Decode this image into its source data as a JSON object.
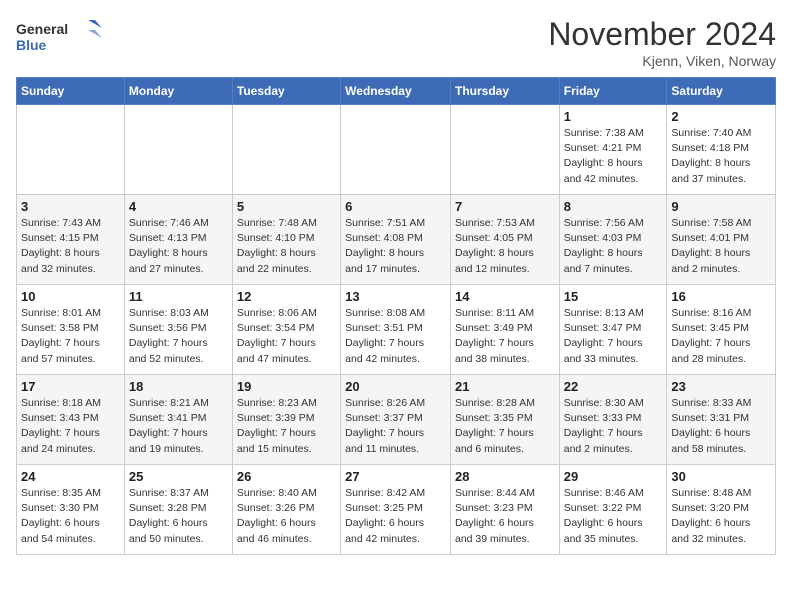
{
  "header": {
    "logo_line1": "General",
    "logo_line2": "Blue",
    "month_title": "November 2024",
    "location": "Kjenn, Viken, Norway"
  },
  "days_of_week": [
    "Sunday",
    "Monday",
    "Tuesday",
    "Wednesday",
    "Thursday",
    "Friday",
    "Saturday"
  ],
  "weeks": [
    [
      {
        "day": "",
        "info": ""
      },
      {
        "day": "",
        "info": ""
      },
      {
        "day": "",
        "info": ""
      },
      {
        "day": "",
        "info": ""
      },
      {
        "day": "",
        "info": ""
      },
      {
        "day": "1",
        "info": "Sunrise: 7:38 AM\nSunset: 4:21 PM\nDaylight: 8 hours\nand 42 minutes."
      },
      {
        "day": "2",
        "info": "Sunrise: 7:40 AM\nSunset: 4:18 PM\nDaylight: 8 hours\nand 37 minutes."
      }
    ],
    [
      {
        "day": "3",
        "info": "Sunrise: 7:43 AM\nSunset: 4:15 PM\nDaylight: 8 hours\nand 32 minutes."
      },
      {
        "day": "4",
        "info": "Sunrise: 7:46 AM\nSunset: 4:13 PM\nDaylight: 8 hours\nand 27 minutes."
      },
      {
        "day": "5",
        "info": "Sunrise: 7:48 AM\nSunset: 4:10 PM\nDaylight: 8 hours\nand 22 minutes."
      },
      {
        "day": "6",
        "info": "Sunrise: 7:51 AM\nSunset: 4:08 PM\nDaylight: 8 hours\nand 17 minutes."
      },
      {
        "day": "7",
        "info": "Sunrise: 7:53 AM\nSunset: 4:05 PM\nDaylight: 8 hours\nand 12 minutes."
      },
      {
        "day": "8",
        "info": "Sunrise: 7:56 AM\nSunset: 4:03 PM\nDaylight: 8 hours\nand 7 minutes."
      },
      {
        "day": "9",
        "info": "Sunrise: 7:58 AM\nSunset: 4:01 PM\nDaylight: 8 hours\nand 2 minutes."
      }
    ],
    [
      {
        "day": "10",
        "info": "Sunrise: 8:01 AM\nSunset: 3:58 PM\nDaylight: 7 hours\nand 57 minutes."
      },
      {
        "day": "11",
        "info": "Sunrise: 8:03 AM\nSunset: 3:56 PM\nDaylight: 7 hours\nand 52 minutes."
      },
      {
        "day": "12",
        "info": "Sunrise: 8:06 AM\nSunset: 3:54 PM\nDaylight: 7 hours\nand 47 minutes."
      },
      {
        "day": "13",
        "info": "Sunrise: 8:08 AM\nSunset: 3:51 PM\nDaylight: 7 hours\nand 42 minutes."
      },
      {
        "day": "14",
        "info": "Sunrise: 8:11 AM\nSunset: 3:49 PM\nDaylight: 7 hours\nand 38 minutes."
      },
      {
        "day": "15",
        "info": "Sunrise: 8:13 AM\nSunset: 3:47 PM\nDaylight: 7 hours\nand 33 minutes."
      },
      {
        "day": "16",
        "info": "Sunrise: 8:16 AM\nSunset: 3:45 PM\nDaylight: 7 hours\nand 28 minutes."
      }
    ],
    [
      {
        "day": "17",
        "info": "Sunrise: 8:18 AM\nSunset: 3:43 PM\nDaylight: 7 hours\nand 24 minutes."
      },
      {
        "day": "18",
        "info": "Sunrise: 8:21 AM\nSunset: 3:41 PM\nDaylight: 7 hours\nand 19 minutes."
      },
      {
        "day": "19",
        "info": "Sunrise: 8:23 AM\nSunset: 3:39 PM\nDaylight: 7 hours\nand 15 minutes."
      },
      {
        "day": "20",
        "info": "Sunrise: 8:26 AM\nSunset: 3:37 PM\nDaylight: 7 hours\nand 11 minutes."
      },
      {
        "day": "21",
        "info": "Sunrise: 8:28 AM\nSunset: 3:35 PM\nDaylight: 7 hours\nand 6 minutes."
      },
      {
        "day": "22",
        "info": "Sunrise: 8:30 AM\nSunset: 3:33 PM\nDaylight: 7 hours\nand 2 minutes."
      },
      {
        "day": "23",
        "info": "Sunrise: 8:33 AM\nSunset: 3:31 PM\nDaylight: 6 hours\nand 58 minutes."
      }
    ],
    [
      {
        "day": "24",
        "info": "Sunrise: 8:35 AM\nSunset: 3:30 PM\nDaylight: 6 hours\nand 54 minutes."
      },
      {
        "day": "25",
        "info": "Sunrise: 8:37 AM\nSunset: 3:28 PM\nDaylight: 6 hours\nand 50 minutes."
      },
      {
        "day": "26",
        "info": "Sunrise: 8:40 AM\nSunset: 3:26 PM\nDaylight: 6 hours\nand 46 minutes."
      },
      {
        "day": "27",
        "info": "Sunrise: 8:42 AM\nSunset: 3:25 PM\nDaylight: 6 hours\nand 42 minutes."
      },
      {
        "day": "28",
        "info": "Sunrise: 8:44 AM\nSunset: 3:23 PM\nDaylight: 6 hours\nand 39 minutes."
      },
      {
        "day": "29",
        "info": "Sunrise: 8:46 AM\nSunset: 3:22 PM\nDaylight: 6 hours\nand 35 minutes."
      },
      {
        "day": "30",
        "info": "Sunrise: 8:48 AM\nSunset: 3:20 PM\nDaylight: 6 hours\nand 32 minutes."
      }
    ]
  ]
}
